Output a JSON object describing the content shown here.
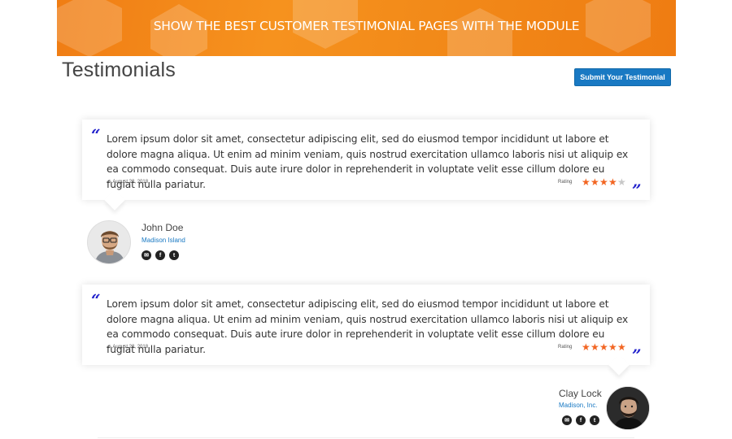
{
  "banner": {
    "text": "SHOW THE BEST CUSTOMER TESTIMONIAL PAGES WITH THE MODULE"
  },
  "page": {
    "title": "Testimonials"
  },
  "submit_button": {
    "label": "Submit Your Testimonial"
  },
  "colors": {
    "banner": "#f6921e",
    "accent": "#1979c3",
    "star": "#f26522",
    "quote": "#2222cc"
  },
  "testimonials": [
    {
      "text": "Lorem ipsum dolor sit amet, consectetur adipiscing elit, sed do eiusmod tempor incididunt ut labore et dolore magna aliqua. Ut enim ad minim veniam, quis nostrud exercitation ullamco laboris nisi ut aliquip ex ea commodo consequat. Duis aute irure dolor in reprehenderit in voluptate velit esse cillum dolore eu fugiat nulla pariatur.",
      "date": "— August 23, 2018",
      "rating_label": "Rating",
      "rating": 4,
      "rating_max": 5,
      "author": {
        "name": "John Doe",
        "company": "Madison Island"
      },
      "social_icons": [
        "email-icon",
        "facebook-icon",
        "twitter-icon"
      ]
    },
    {
      "text": "Lorem ipsum dolor sit amet, consectetur adipiscing elit, sed do eiusmod tempor incididunt ut labore et dolore magna aliqua. Ut enim ad minim veniam, quis nostrud exercitation ullamco laboris nisi ut aliquip ex ea commodo consequat. Duis aute irure dolor in reprehenderit in voluptate velit esse cillum dolore eu fugiat nulla pariatur.",
      "date": "— August 23, 2018",
      "rating_label": "Rating",
      "rating": 5,
      "rating_max": 5,
      "author": {
        "name": "Clay Lock",
        "company": "Madison, Inc."
      },
      "social_icons": [
        "email-icon",
        "facebook-icon",
        "twitter-icon"
      ]
    }
  ]
}
